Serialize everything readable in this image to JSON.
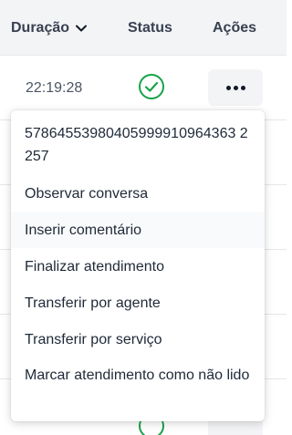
{
  "table": {
    "headers": {
      "duracao": "Duração",
      "status": "Status",
      "acoes": "Ações"
    },
    "rows": [
      {
        "duration": "22:19:28",
        "status_icon": "check-circle-icon",
        "actions_icon": "more-horizontal-icon"
      }
    ]
  },
  "menu": {
    "id_label": "57864553980405999910964363 2257",
    "items": [
      "Observar conversa",
      "Inserir comentário",
      "Finalizar atendimento",
      "Transferir por agente",
      "Transferir por serviço",
      "Marcar atendimento como não lido"
    ]
  },
  "colors": {
    "header_bg": "#f3f4f6",
    "success_green": "#16a34a",
    "button_bg": "#f3f4f6"
  }
}
